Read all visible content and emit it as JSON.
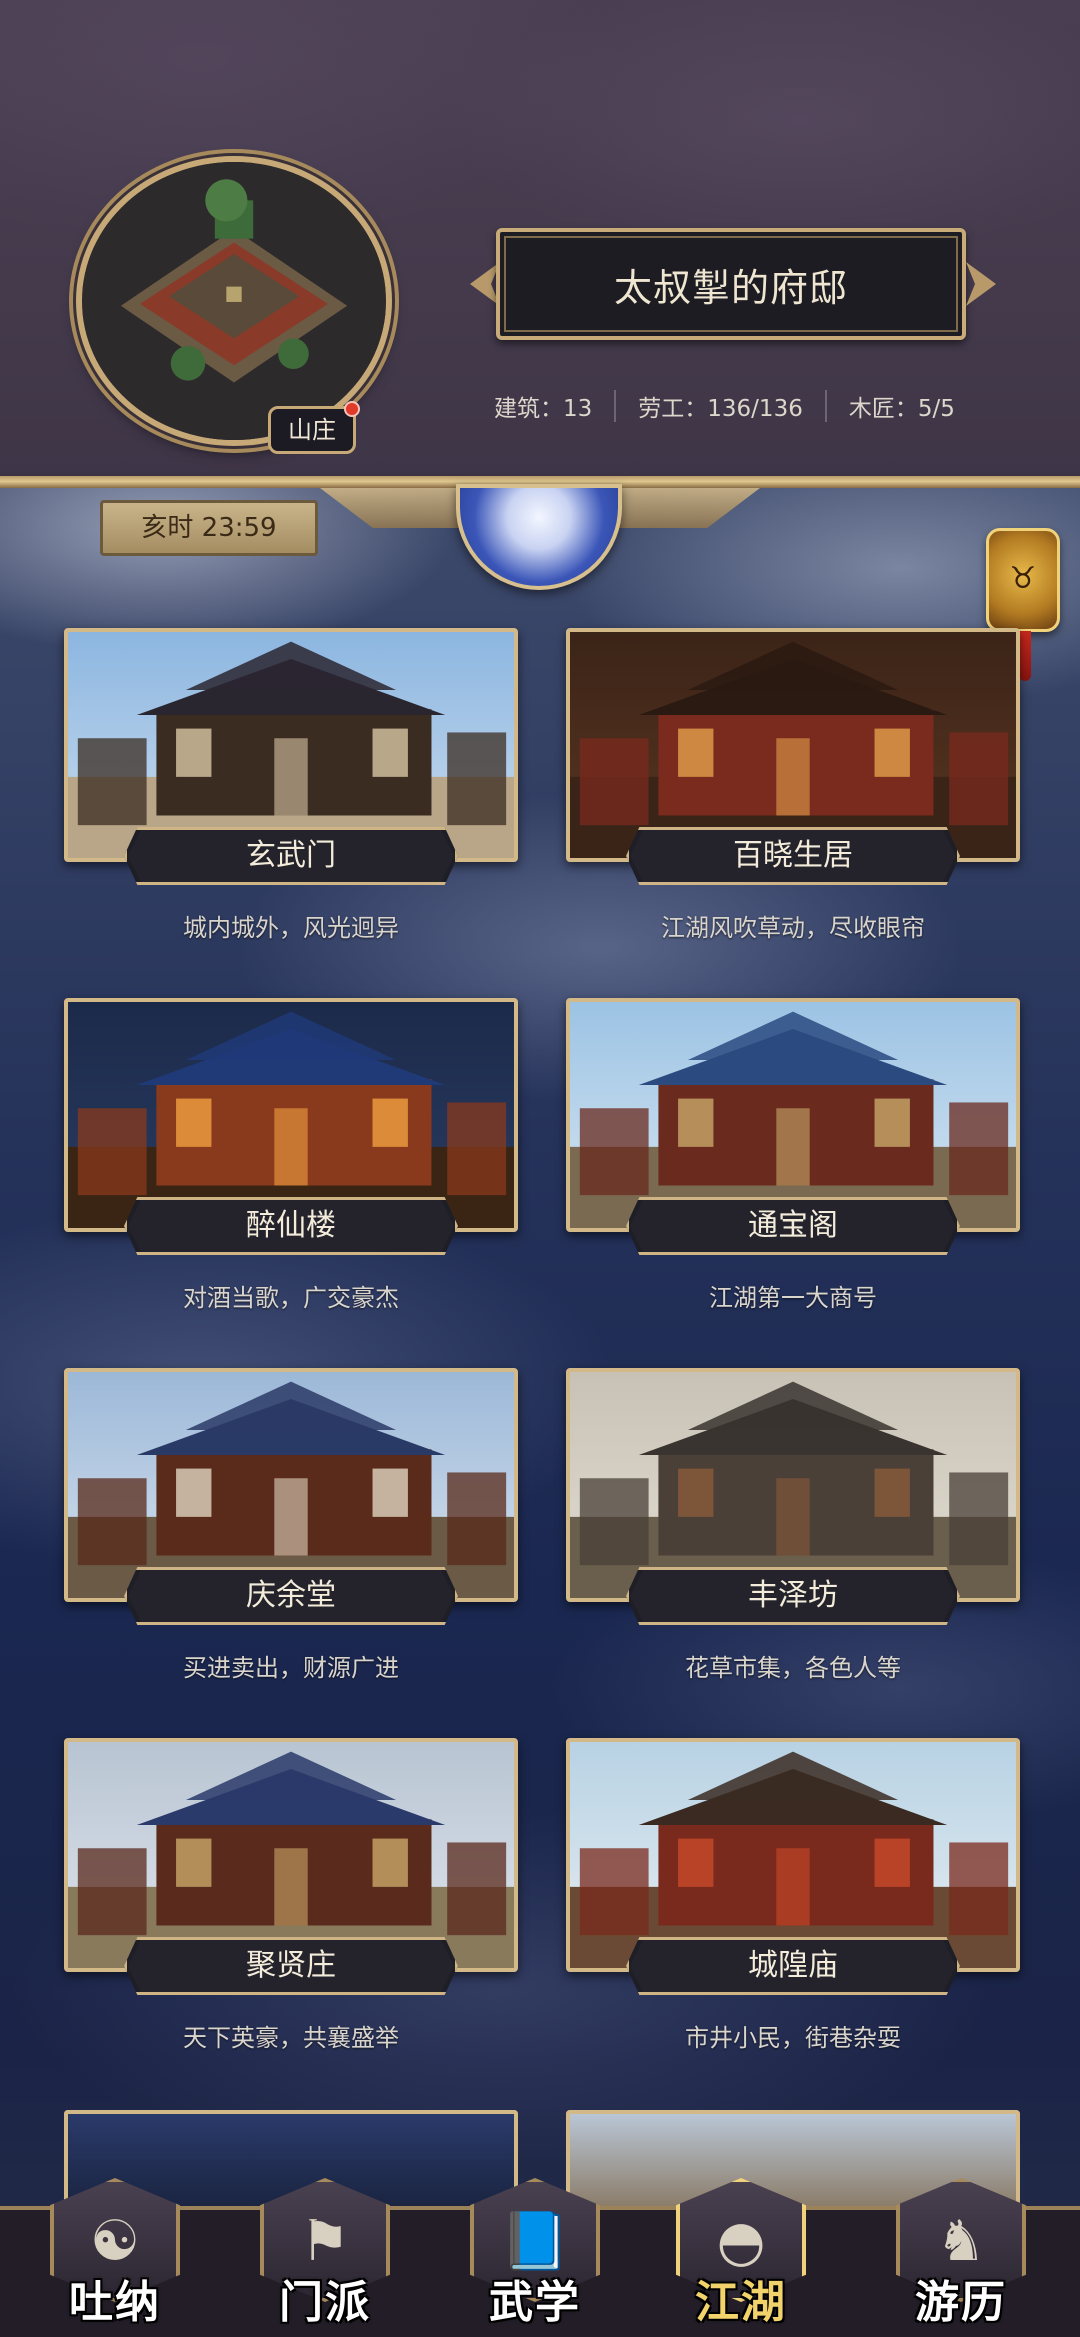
{
  "header": {
    "manor_label": "山庄",
    "title": "太叔掣的府邸",
    "stats": [
      {
        "label": "建筑：13"
      },
      {
        "label": "劳工：136/136"
      },
      {
        "label": "木匠：5/5"
      }
    ]
  },
  "time": "亥时 23:59",
  "locations": [
    {
      "name": "玄武门",
      "desc": "城内城外，风光迥异",
      "theme": "gate"
    },
    {
      "name": "百晓生居",
      "desc": "江湖风吹草动，尽收眼帘",
      "theme": "interior"
    },
    {
      "name": "醉仙楼",
      "desc": "对酒当歌，广交豪杰",
      "theme": "night"
    },
    {
      "name": "通宝阁",
      "desc": "江湖第一大商号",
      "theme": "tower"
    },
    {
      "name": "庆余堂",
      "desc": "买进卖出，财源广进",
      "theme": "shop"
    },
    {
      "name": "丰泽坊",
      "desc": "花草市集，各色人等",
      "theme": "market"
    },
    {
      "name": "聚贤庄",
      "desc": "天下英豪，共襄盛举",
      "theme": "manor"
    },
    {
      "name": "城隍庙",
      "desc": "市井小民，街巷杂耍",
      "theme": "temple"
    }
  ],
  "bottom_nav": [
    {
      "label": "吐纳",
      "icon": "meditation-icon",
      "glyph": "☯"
    },
    {
      "label": "门派",
      "icon": "sect-icon",
      "glyph": "⚑"
    },
    {
      "label": "武学",
      "icon": "martial-book-icon",
      "glyph": "📘"
    },
    {
      "label": "江湖",
      "icon": "straw-hat-icon",
      "glyph": "◓",
      "active": true
    },
    {
      "label": "游历",
      "icon": "horse-icon",
      "glyph": "♞"
    }
  ],
  "colors": {
    "gold_border": "#d3b888",
    "active_label": "#f2d36b",
    "badge_dot": "#e03a2a"
  }
}
